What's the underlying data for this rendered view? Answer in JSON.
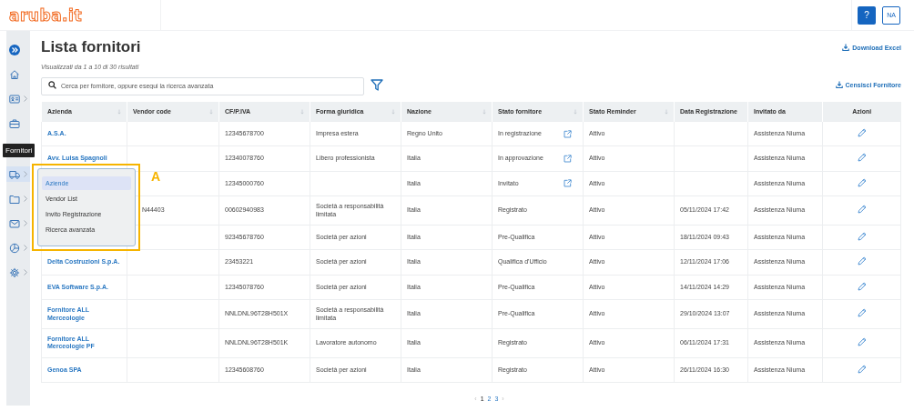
{
  "header": {
    "logo": "aruba.it",
    "help": "?",
    "user": "NA"
  },
  "sidebar": {
    "items": [
      {
        "submenu": false,
        "selected": false
      },
      {
        "submenu": false,
        "selected": false
      },
      {
        "submenu": true,
        "selected": false
      },
      {
        "submenu": false,
        "selected": false
      },
      {
        "submenu": true,
        "selected": true
      },
      {
        "submenu": true,
        "selected": false
      },
      {
        "submenu": true,
        "selected": false
      },
      {
        "submenu": true,
        "selected": false
      },
      {
        "submenu": true,
        "selected": false
      }
    ]
  },
  "tooltip": "Fornitori",
  "menu": {
    "items": [
      {
        "label": "Aziende",
        "selected": true
      },
      {
        "label": "Vendor List",
        "selected": false
      },
      {
        "label": "Invito Registrazione",
        "selected": false
      },
      {
        "label": "Ricerca avanzata",
        "selected": false
      }
    ]
  },
  "annotation": "A",
  "page": {
    "title": "Lista fornitori",
    "subtitle": "Visualizzati da 1 a 10 di 30 risultati",
    "search": {
      "placeholder": "Cerca per fornitore, oppure esegui la ricerca avanzata"
    },
    "download": "Download Excel",
    "create": "Censisci Fornitore"
  },
  "table": {
    "columns": [
      {
        "label": "Azienda",
        "sortable": true
      },
      {
        "label": "Vendor code",
        "sortable": true
      },
      {
        "label": "CF/P.IVA",
        "sortable": true
      },
      {
        "label": "Forma giuridica",
        "sortable": true
      },
      {
        "label": "Nazione",
        "sortable": true
      },
      {
        "label": "Stato fornitore",
        "sortable": true
      },
      {
        "label": "Stato Reminder",
        "sortable": true
      },
      {
        "label": "Data Registrazione",
        "sortable": false
      },
      {
        "label": "Invitato da",
        "sortable": false
      },
      {
        "label": "Azioni",
        "sortable": false
      }
    ],
    "rows": [
      {
        "azienda": "A.S.A.",
        "cf": "12345678700",
        "forma": "Impresa estera",
        "nazione": "Regno Unito",
        "stato": "In registrazione",
        "link": true,
        "reminder": "Attivo",
        "invitato": "Assistenza Niuma"
      },
      {
        "azienda": "Avv. Luisa Spagnoli",
        "cf": "12340078760",
        "forma": "Libero professionista",
        "nazione": "Italia",
        "stato": "In approvazione",
        "link": true,
        "reminder": "Attivo",
        "invitato": "Assistenza Niuma"
      },
      {
        "cf": "12345000760",
        "nazione": "Italia",
        "stato": "Invitato",
        "link": true,
        "reminder": "Attivo",
        "invitato": "Assistenza Niuma"
      },
      {
        "vendor": "N44403",
        "cf": "00602940983",
        "forma": "Società a responsabilità limitata",
        "nazione": "Italia",
        "stato": "Registrato",
        "link": false,
        "reminder": "Attivo",
        "data": "05/11/2024 17:42",
        "invitato": "Assistenza Niuma"
      },
      {
        "cf": "92345678760",
        "forma": "Società per azioni",
        "nazione": "Italia",
        "stato": "Pre-Qualifica",
        "link": false,
        "reminder": "Attivo",
        "data": "18/11/2024 09:43",
        "invitato": "Assistenza Niuma"
      },
      {
        "azienda": "Delta Costruzioni S.p.A.",
        "cf": "23453221",
        "forma": "Società per azioni",
        "nazione": "Italia",
        "stato": "Qualifica d'Ufficio",
        "link": false,
        "reminder": "Attivo",
        "data": "12/11/2024 17:06",
        "invitato": "Assistenza Niuma"
      },
      {
        "azienda": "EVA Software S.p.A.",
        "cf": "12345078760",
        "forma": "Società per azioni",
        "nazione": "Italia",
        "stato": "Pre-Qualifica",
        "link": false,
        "reminder": "Attivo",
        "data": "14/11/2024 14:29",
        "invitato": "Assistenza Niuma"
      },
      {
        "azienda": "Fornitore ALL Merceologie",
        "cf": "NNLDNL96T28H501X",
        "forma": "Società a responsabilità limitata",
        "nazione": "Italia",
        "stato": "Pre-Qualifica",
        "link": false,
        "reminder": "Attivo",
        "data": "29/10/2024 13:07",
        "invitato": "Assistenza Niuma"
      },
      {
        "azienda": "Fornitore ALL Merceologie PF",
        "cf": "NNLDNL96T28H501K",
        "forma": "Lavoratore autonomo",
        "nazione": "Italia",
        "stato": "Registrato",
        "link": false,
        "reminder": "Attivo",
        "data": "06/11/2024 17:31",
        "invitato": "Assistenza Niuma"
      },
      {
        "azienda": "Genoa SPA",
        "cf": "12345608760",
        "forma": "Società per azioni",
        "nazione": "Italia",
        "stato": "Registrato",
        "link": false,
        "reminder": "Attivo",
        "data": "26/11/2024 16:30",
        "invitato": "Assistenza Niuma"
      }
    ]
  },
  "pagination": {
    "prev": "‹",
    "next": "›",
    "pages": [
      {
        "label": "1",
        "selected": true
      },
      {
        "label": "2",
        "selected": false
      },
      {
        "label": "3",
        "selected": false
      }
    ]
  }
}
